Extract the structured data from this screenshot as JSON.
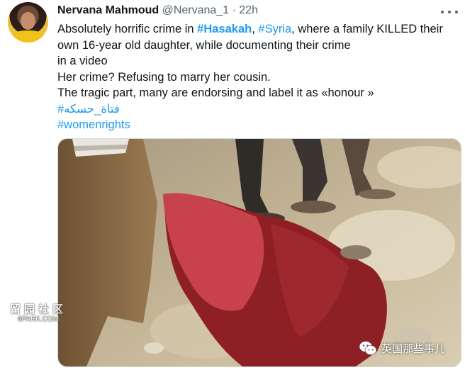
{
  "tweet": {
    "author_name": "Nervana Mahmoud",
    "handle": "@Nervana_1",
    "separator": "·",
    "time": "22h",
    "lines": {
      "l1_pre": "Absolutely horrific crime  in ",
      "l1_tag1": "#Hasakah",
      "l1_mid": ", ",
      "l1_tag2": "#Syria",
      "l1_post": ", where a family KILLED their",
      "l2": "own 16-year old daughter, while documenting their crime",
      "l3": "in a video",
      "l4": "Her crime? Refusing to marry her cousin.",
      "l5": "The tragic part, many are endorsing and label it  as «honour »",
      "l6_tag": "#فتاة_حسكه",
      "l7_tag": "#womenrights"
    }
  },
  "watermarks": {
    "left_cn": "留园社区",
    "left_en": "6PARK.COM",
    "right_cn": "英国那些事儿"
  },
  "icons": {
    "more": "more-horizontal-icon",
    "wechat": "wechat-icon"
  },
  "colors": {
    "link": "#1d9bf0",
    "text": "#0f1419",
    "muted": "#536471"
  }
}
